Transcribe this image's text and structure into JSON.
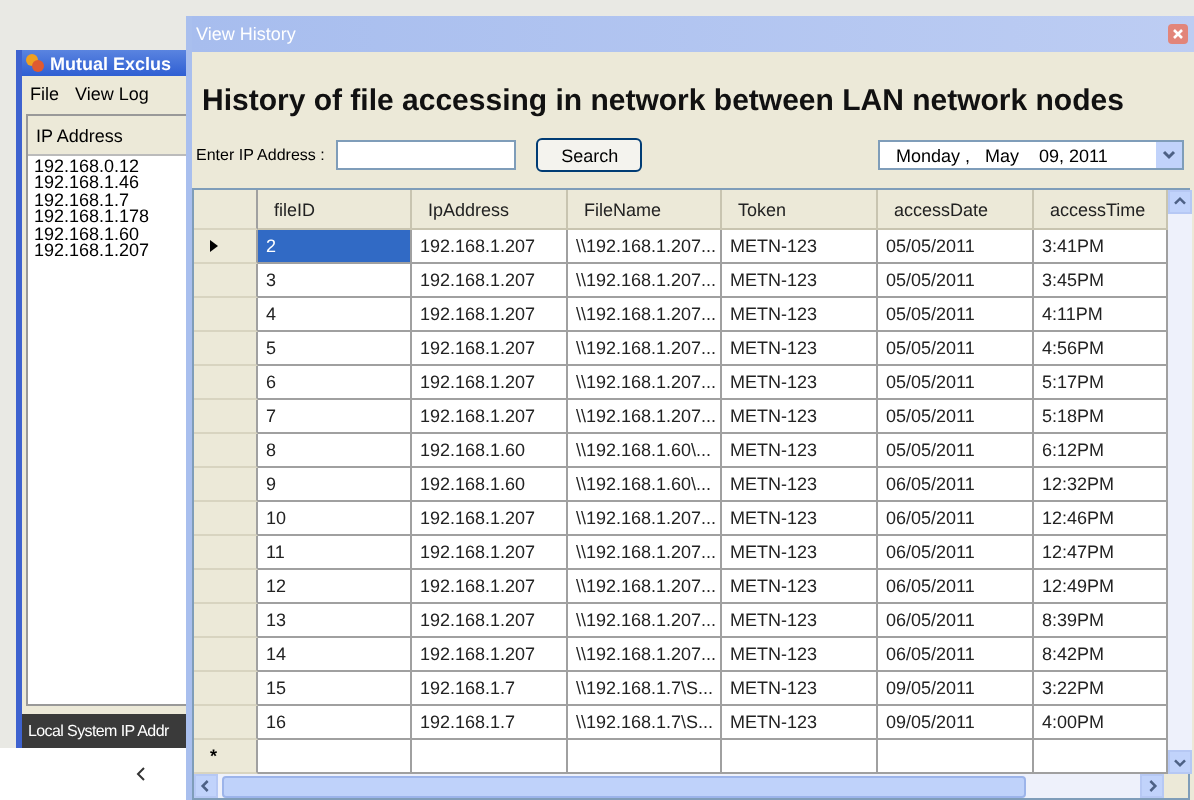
{
  "back_window": {
    "title": "Mutual Exclus",
    "menu": [
      "File",
      "View Log"
    ],
    "ip_list": {
      "header": "IP Address",
      "items": [
        "192.168.0.12",
        "192.168.1.46",
        "192.168.1.7",
        "192.168.1.178",
        "192.168.1.60",
        "192.168.1.207"
      ]
    },
    "status": "Local System IP Addr"
  },
  "window": {
    "title": "View History",
    "heading": "History of file accessing in network between LAN network nodes",
    "ip_label": "Enter IP Address :",
    "search_button": "Search",
    "date": "Monday ,   May    09, 2011",
    "table": {
      "columns": [
        "fileID",
        "IpAddress",
        "FileName",
        "Token",
        "accessDate",
        "accessTime"
      ],
      "rows": [
        {
          "selected": true,
          "cells": [
            "2",
            "192.168.1.207",
            "\\\\192.168.1.207...",
            "METN-123",
            "05/05/2011",
            "3:41PM"
          ]
        },
        {
          "selected": false,
          "cells": [
            "3",
            "192.168.1.207",
            "\\\\192.168.1.207...",
            "METN-123",
            "05/05/2011",
            "3:45PM"
          ]
        },
        {
          "selected": false,
          "cells": [
            "4",
            "192.168.1.207",
            "\\\\192.168.1.207...",
            "METN-123",
            "05/05/2011",
            "4:11PM"
          ]
        },
        {
          "selected": false,
          "cells": [
            "5",
            "192.168.1.207",
            "\\\\192.168.1.207...",
            "METN-123",
            "05/05/2011",
            "4:56PM"
          ]
        },
        {
          "selected": false,
          "cells": [
            "6",
            "192.168.1.207",
            "\\\\192.168.1.207...",
            "METN-123",
            "05/05/2011",
            "5:17PM"
          ]
        },
        {
          "selected": false,
          "cells": [
            "7",
            "192.168.1.207",
            "\\\\192.168.1.207...",
            "METN-123",
            "05/05/2011",
            "5:18PM"
          ]
        },
        {
          "selected": false,
          "cells": [
            "8",
            "192.168.1.60",
            "\\\\192.168.1.60\\...",
            "METN-123",
            "05/05/2011",
            "6:12PM"
          ]
        },
        {
          "selected": false,
          "cells": [
            "9",
            "192.168.1.60",
            "\\\\192.168.1.60\\...",
            "METN-123",
            "06/05/2011",
            "12:32PM"
          ]
        },
        {
          "selected": false,
          "cells": [
            "10",
            "192.168.1.207",
            "\\\\192.168.1.207...",
            "METN-123",
            "06/05/2011",
            "12:46PM"
          ]
        },
        {
          "selected": false,
          "cells": [
            "11",
            "192.168.1.207",
            "\\\\192.168.1.207...",
            "METN-123",
            "06/05/2011",
            "12:47PM"
          ]
        },
        {
          "selected": false,
          "cells": [
            "12",
            "192.168.1.207",
            "\\\\192.168.1.207...",
            "METN-123",
            "06/05/2011",
            "12:49PM"
          ]
        },
        {
          "selected": false,
          "cells": [
            "13",
            "192.168.1.207",
            "\\\\192.168.1.207...",
            "METN-123",
            "06/05/2011",
            "8:39PM"
          ]
        },
        {
          "selected": false,
          "cells": [
            "14",
            "192.168.1.207",
            "\\\\192.168.1.207...",
            "METN-123",
            "06/05/2011",
            "8:42PM"
          ]
        },
        {
          "selected": false,
          "cells": [
            "15",
            "192.168.1.7",
            "\\\\192.168.1.7\\S...",
            "METN-123",
            "09/05/2011",
            "3:22PM"
          ]
        },
        {
          "selected": false,
          "cells": [
            "16",
            "192.168.1.7",
            "\\\\192.168.1.7\\S...",
            "METN-123",
            "09/05/2011",
            "4:00PM"
          ]
        }
      ],
      "new_row_marker": "*"
    }
  }
}
